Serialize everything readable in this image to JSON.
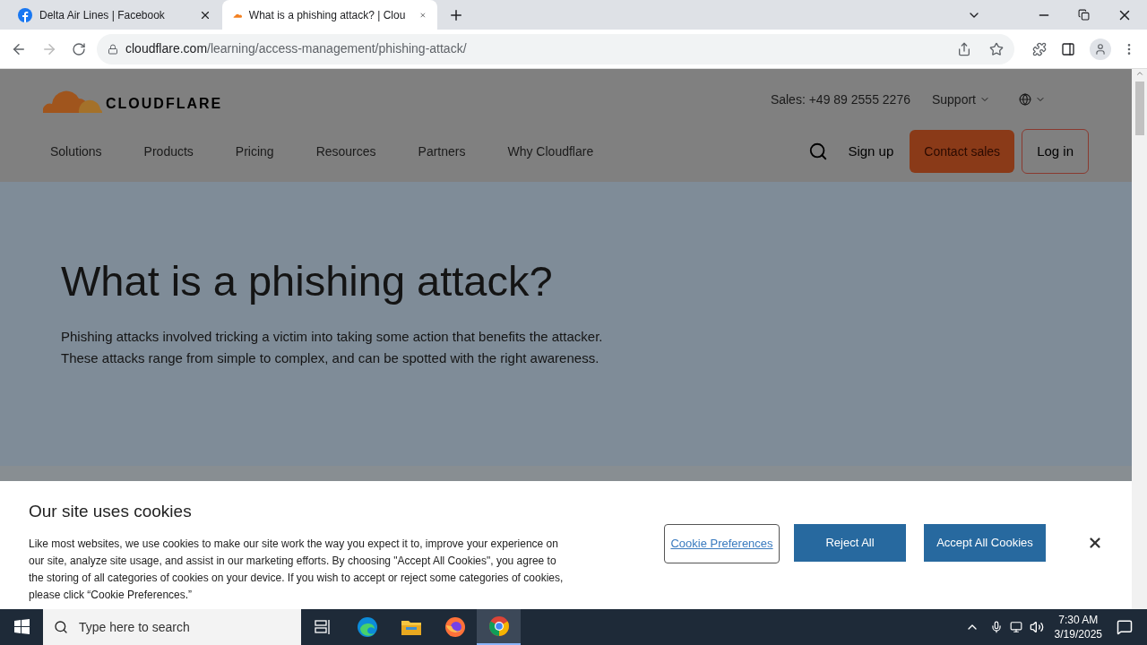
{
  "browser_tabs": [
    {
      "title": "Delta Air Lines | Facebook",
      "kind": "facebook",
      "selected": false
    },
    {
      "title": "What is a phishing attack? | Clou",
      "kind": "cloudflare",
      "selected": true
    }
  ],
  "address": {
    "host": "cloudflare.com",
    "path": "/learning/access-management/phishing-attack/"
  },
  "header": {
    "logo": "CLOUDFLARE",
    "sales": "Sales: +49 89 2555 2276",
    "support": "Support",
    "nav": [
      "Solutions",
      "Products",
      "Pricing",
      "Resources",
      "Partners",
      "Why Cloudflare"
    ],
    "sign_up": "Sign up",
    "contact": "Contact sales",
    "login": "Log in"
  },
  "hero": {
    "title": "What is a phishing attack?",
    "lines": [
      "Phishing attacks involved tricking a victim into taking some action that benefits the attacker.",
      "These attacks range from simple to complex, and can be spotted with the right awareness."
    ]
  },
  "cookies": {
    "title": "Our site uses cookies",
    "lines": [
      "Like most websites, we use cookies to make our site work the way you expect it to, improve your experience on",
      "our site, analyze site usage, and assist in our marketing efforts. By choosing \"Accept All Cookies\", you agree to",
      "the storing of all categories of cookies on your device. If you wish to accept or reject some categories of cookies,",
      "please click “Cookie Preferences.”"
    ],
    "preferences": "Cookie Preferences",
    "reject": "Reject All",
    "accept": "Accept All Cookies"
  },
  "taskbar": {
    "search_placeholder": "Type here to search",
    "apps": [
      {
        "kind": "taskview",
        "selected": false
      },
      {
        "kind": "edge",
        "selected": false
      },
      {
        "kind": "explorer",
        "selected": false
      },
      {
        "kind": "firefox",
        "selected": false
      },
      {
        "kind": "chrome",
        "selected": true
      }
    ],
    "time": "7:30 AM",
    "date": "3/19/2025"
  }
}
